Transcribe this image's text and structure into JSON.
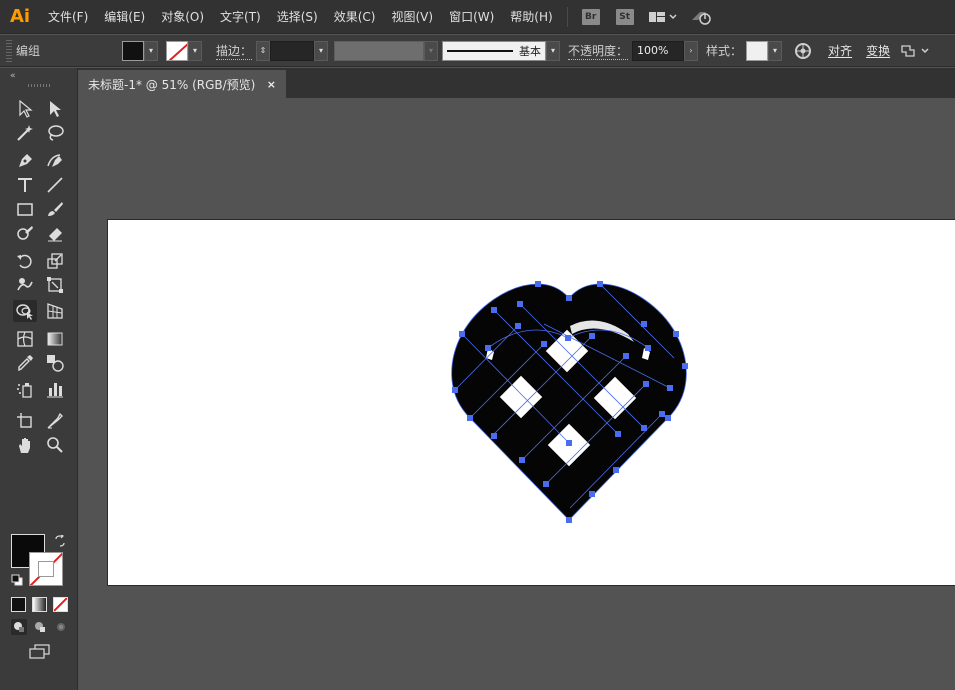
{
  "app": {
    "logo": "Ai"
  },
  "menu": {
    "items": [
      {
        "label": "文件(F)",
        "name": "menu-file"
      },
      {
        "label": "编辑(E)",
        "name": "menu-edit"
      },
      {
        "label": "对象(O)",
        "name": "menu-object"
      },
      {
        "label": "文字(T)",
        "name": "menu-type"
      },
      {
        "label": "选择(S)",
        "name": "menu-select"
      },
      {
        "label": "效果(C)",
        "name": "menu-effect"
      },
      {
        "label": "视图(V)",
        "name": "menu-view"
      },
      {
        "label": "窗口(W)",
        "name": "menu-window"
      },
      {
        "label": "帮助(H)",
        "name": "menu-help"
      }
    ],
    "bridge_label": "Br",
    "stock_label": "St"
  },
  "control": {
    "selection_label": "编组",
    "stroke_label": "描边：",
    "brush_label": "基本",
    "opacity_label": "不透明度：",
    "opacity_value": "100%",
    "style_label": "样式：",
    "align_label": "对齐",
    "transform_label": "变换"
  },
  "document": {
    "tab_title": "未标题-1* @ 51% (RGB/预览)",
    "close_symbol": "×"
  },
  "colors": {
    "accent": "#ff9a00",
    "selection": "#4a6cf0",
    "artwork": "#050505",
    "canvas": "#535353",
    "artboard": "#ffffff"
  }
}
